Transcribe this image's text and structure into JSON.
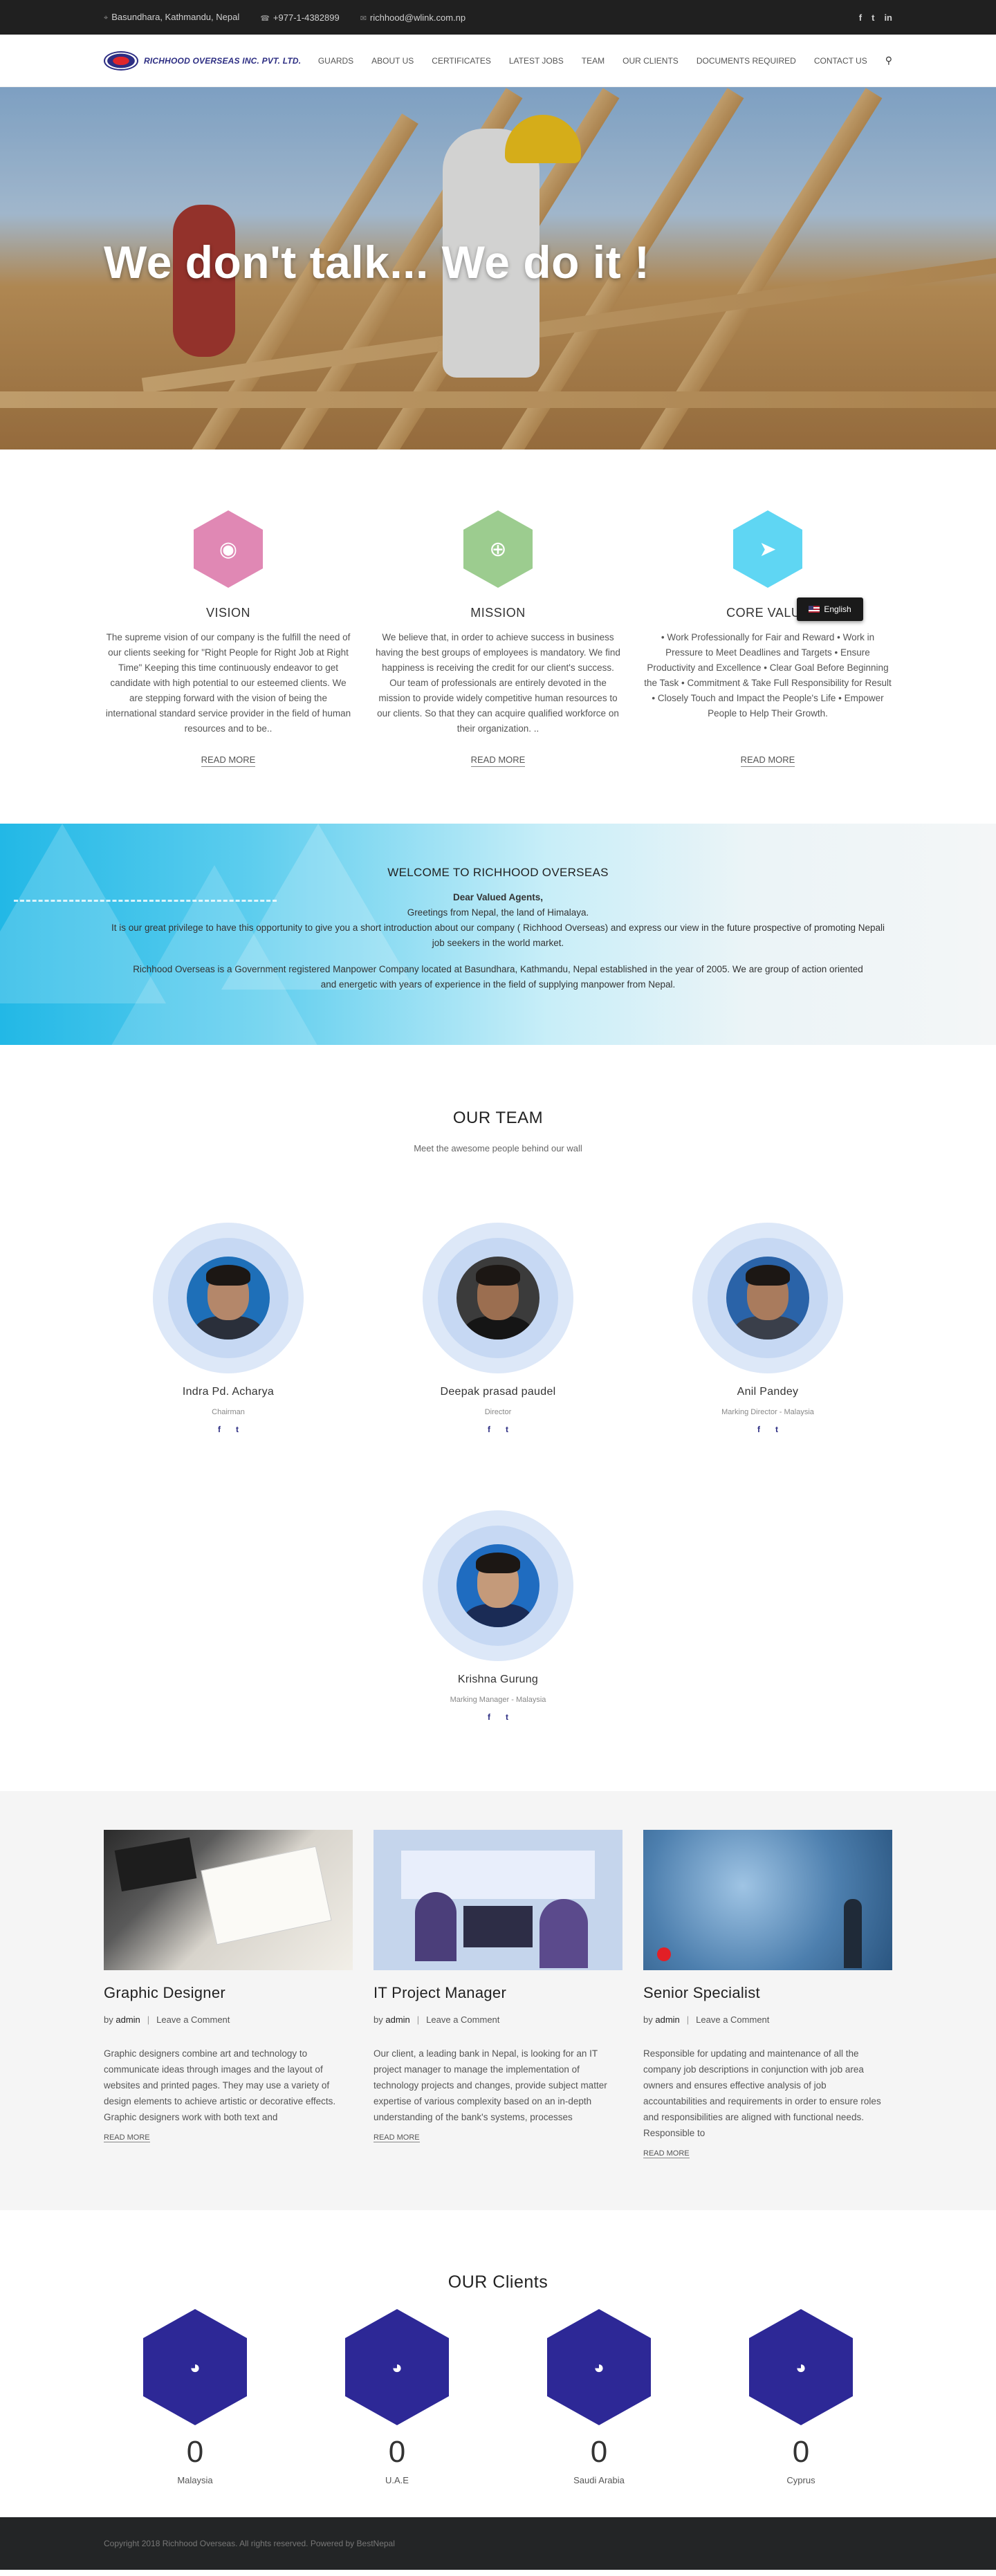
{
  "topbar": {
    "address": "Basundhara, Kathmandu, Nepal",
    "phone": "+977-1-4382899",
    "email": "richhood@wlink.com.np",
    "social": [
      "f",
      "t",
      "in"
    ]
  },
  "brand": {
    "name": "RICHHOOD OVERSEAS INC. PVT. LTD."
  },
  "nav": [
    "GUARDS",
    "ABOUT US",
    "CERTIFICATES",
    "LATEST JOBS",
    "TEAM",
    "OUR CLIENTS",
    "DOCUMENTS REQUIRED",
    "CONTACT US"
  ],
  "hero": {
    "title": "We don't talk... We do it !"
  },
  "features": [
    {
      "title": "VISION",
      "text": "The supreme vision of our company is the fulfill the need of our clients seeking for \"Right People for Right Job at Right Time\" Keeping this time continuously endeavor to get candidate with high potential to our esteemed clients. We are stepping forward with the vision of being the international standard service provider in the field of human resources and to be..",
      "readmore": "READ MORE",
      "color": "#e088b4",
      "icon": "eye-icon"
    },
    {
      "title": "MISSION",
      "text": "We believe that, in order to achieve success in business having the best groups of employees is mandatory. We find happiness is receiving the credit for our client's success. Our team of professionals are entirely devoted in the mission to provide widely competitive human resources to our clients. So that they can acquire qualified workforce on their organization. ..",
      "readmore": "READ MORE",
      "color": "#9ccc8f",
      "icon": "lifebuoy-icon"
    },
    {
      "title": "CORE VALUE",
      "text": "• Work Professionally for Fair and Reward • Work in Pressure to Meet Deadlines and Targets • Ensure Productivity and Excellence • Clear Goal Before Beginning the Task • Commitment & Take Full Responsibility for Result • Closely Touch and Impact the People's Life • Empower People to Help Their Growth.",
      "readmore": "READ MORE",
      "color": "#5fd6f3",
      "icon": "rocket-icon"
    }
  ],
  "language": {
    "label": "English"
  },
  "welcome": {
    "title": "WELCOME TO RICHHOOD OVERSEAS",
    "greeting_title": "Dear Valued Agents,",
    "greeting_line": "Greetings from Nepal, the land of Himalaya.",
    "intro": "It is our great privilege to have this opportunity to give you a short introduction about our company ( Richhood Overseas) and express our view in the future prospective of promoting Nepali job seekers in the world market.",
    "about": "Richhood Overseas is a Government registered Manpower Company located at Basundhara, Kathmandu, Nepal established in the year of 2005. We are group of action oriented and energetic with years of experience in the field of supplying manpower from Nepal."
  },
  "team": {
    "title": "OUR TEAM",
    "subtitle": "Meet the awesome people behind our wall",
    "members": [
      {
        "name": "Indra Pd. Acharya",
        "role": "Chairman"
      },
      {
        "name": "Deepak prasad paudel",
        "role": "Director"
      },
      {
        "name": "Anil Pandey",
        "role": "Marking Director - Malaysia"
      },
      {
        "name": "Krishna Gurung",
        "role": "Marking Manager - Malaysia"
      }
    ]
  },
  "jobs": [
    {
      "title": "Graphic Designer",
      "author": "admin",
      "comment": "Leave a Comment",
      "excerpt": "Graphic designers combine art and technology to communicate ideas through images and the layout of websites and printed pages. They may use a variety of design elements to achieve artistic or decorative effects. Graphic designers work with both text and",
      "readmore": "READ MORE"
    },
    {
      "title": "IT Project Manager",
      "author": "admin",
      "comment": "Leave a Comment",
      "excerpt": "Our client, a leading bank in Nepal, is looking for an IT project manager to manage the implementation of technology projects and changes, provide subject matter expertise of various complexity based on an in-depth understanding of the bank's systems, processes",
      "readmore": "READ MORE"
    },
    {
      "title": "Senior Specialist",
      "author": "admin",
      "comment": "Leave a Comment",
      "excerpt": "Responsible for updating and maintenance of all the company job descriptions in conjunction with job area owners and ensures effective analysis of job accountabilities and requirements in order to ensure roles and responsibilities are aligned with functional needs. Responsible to",
      "readmore": "READ MORE"
    }
  ],
  "jobs_labels": {
    "by": "by",
    "sep": "|"
  },
  "clients": {
    "title": "OUR Clients",
    "items": [
      {
        "count": "0",
        "country": "Malaysia"
      },
      {
        "count": "0",
        "country": "U.A.E"
      },
      {
        "count": "0",
        "country": "Saudi Arabia"
      },
      {
        "count": "0",
        "country": "Cyprus"
      }
    ]
  },
  "footer": {
    "text": "Copyright 2018 Richhood Overseas. All rights reserved. Powered by BestNepal"
  }
}
